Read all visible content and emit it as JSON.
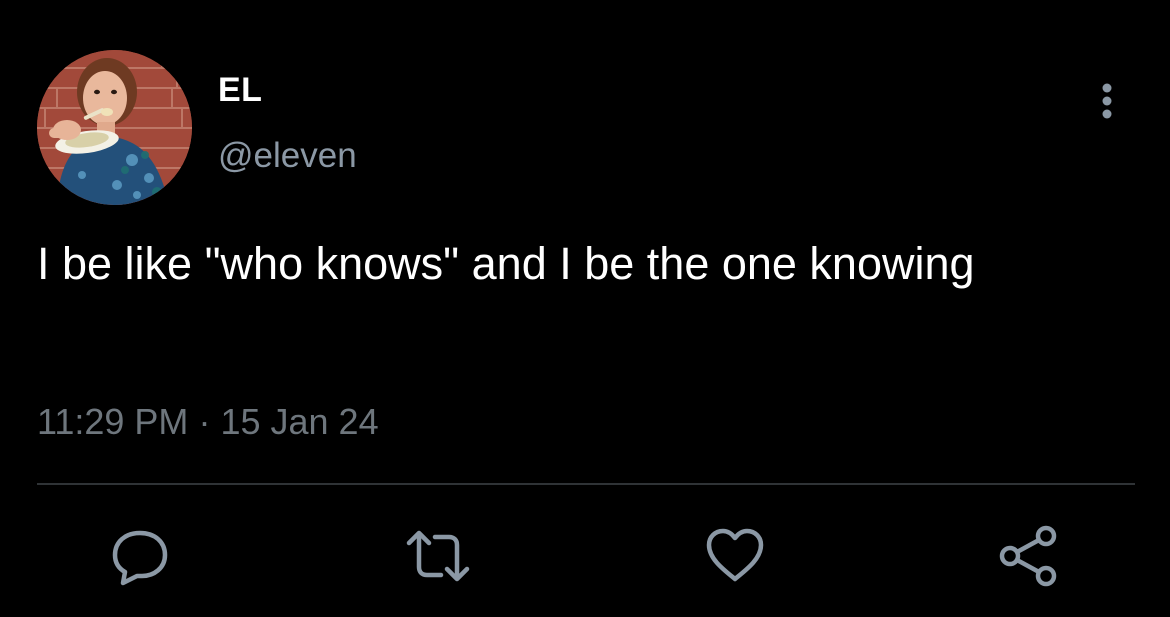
{
  "tweet": {
    "display_name": "EL",
    "handle": "@eleven",
    "text": "I be like \"who knows\" and I be the one knowing",
    "time": "11:29 PM",
    "separator": "·",
    "date": "15 Jan 24"
  },
  "icons": {
    "more": "more-vertical-icon",
    "reply": "reply-icon",
    "retweet": "retweet-icon",
    "like": "heart-icon",
    "share": "share-icon"
  },
  "colors": {
    "background": "#000000",
    "text": "#ffffff",
    "secondary": "#8b98a5",
    "icon": "#8b98a5",
    "divider": "#2f3336"
  }
}
